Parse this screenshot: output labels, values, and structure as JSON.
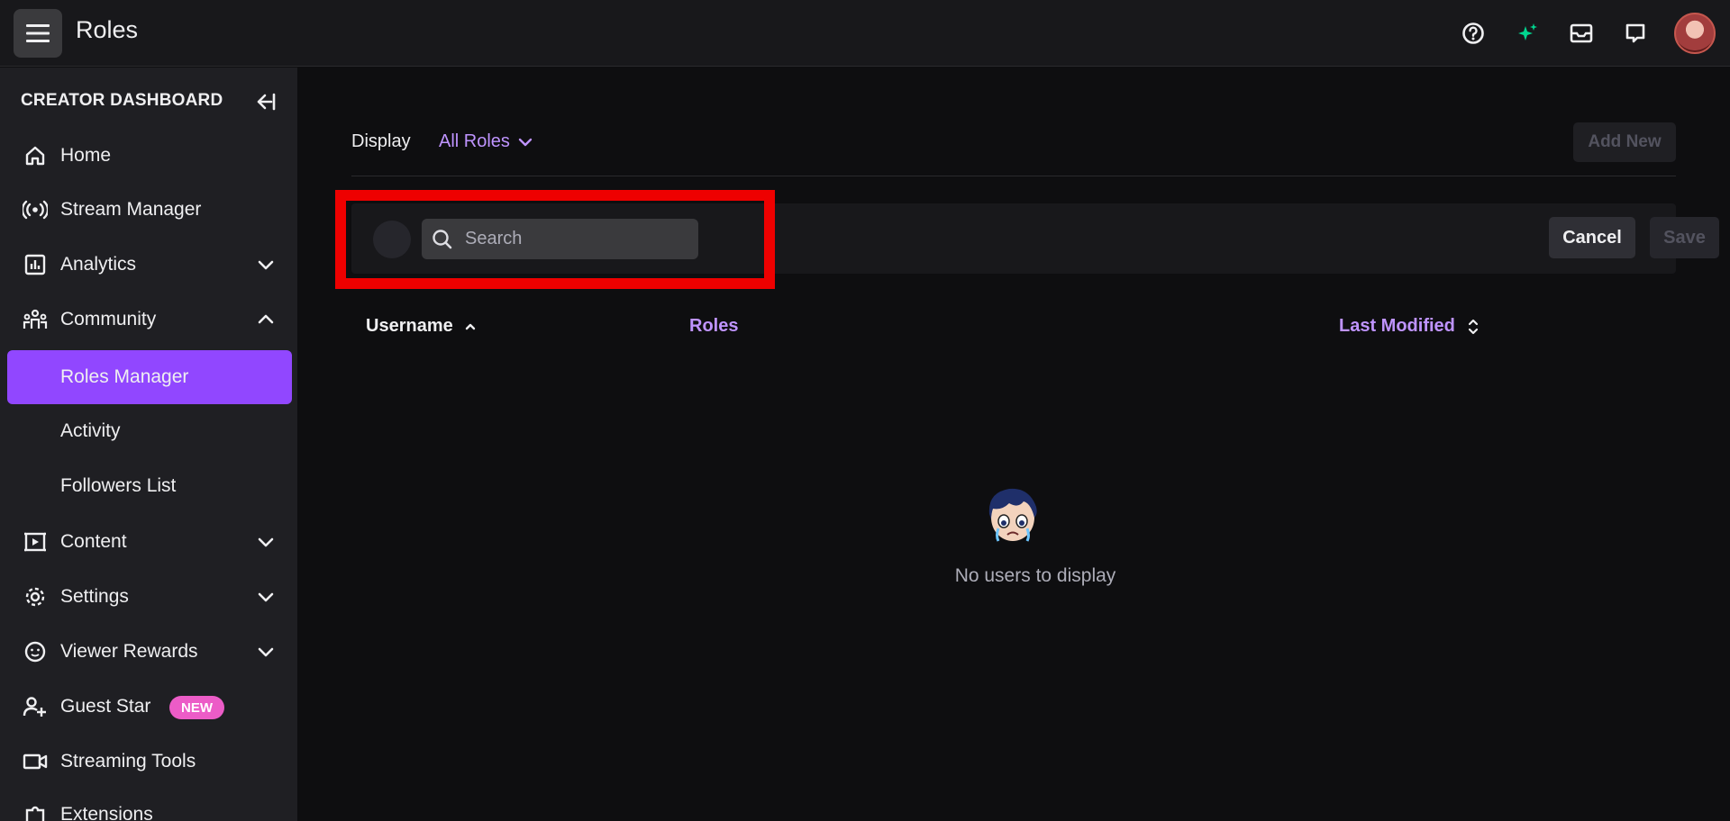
{
  "topbar": {
    "title": "Roles",
    "icons": [
      "menu-icon",
      "help-icon",
      "sparkle-icon",
      "inbox-icon",
      "whispers-icon",
      "user-avatar"
    ]
  },
  "sidebar": {
    "header": "CREATOR DASHBOARD",
    "items": [
      {
        "label": "Home",
        "icon": "home-icon"
      },
      {
        "label": "Stream Manager",
        "icon": "broadcast-icon"
      },
      {
        "label": "Analytics",
        "icon": "analytics-icon",
        "expandable": true
      },
      {
        "label": "Community",
        "icon": "community-icon",
        "expanded": true
      },
      {
        "label": "Roles Manager",
        "active": true
      },
      {
        "label": "Activity"
      },
      {
        "label": "Followers List"
      },
      {
        "label": "Content",
        "icon": "content-icon",
        "expandable": true
      },
      {
        "label": "Settings",
        "icon": "gear-icon",
        "expandable": true
      },
      {
        "label": "Viewer Rewards",
        "icon": "smile-icon",
        "expandable": true
      },
      {
        "label": "Guest Star",
        "icon": "add-user-icon",
        "badge": "NEW"
      },
      {
        "label": "Streaming Tools",
        "icon": "camera-icon"
      },
      {
        "label": "Extensions",
        "icon": "puzzle-icon"
      }
    ]
  },
  "main": {
    "display_label": "Display",
    "roles_filter": "All Roles",
    "add_new": "Add New",
    "search": {
      "placeholder": "Search"
    },
    "cancel": "Cancel",
    "save": "Save",
    "columns": {
      "username": "Username",
      "roles": "Roles",
      "last_modified": "Last Modified"
    },
    "empty_message": "No users to display"
  },
  "colors": {
    "accent": "#9147ff",
    "link": "#bf94ff",
    "highlight": "#ee0000",
    "badge": "#ec5cc7"
  }
}
